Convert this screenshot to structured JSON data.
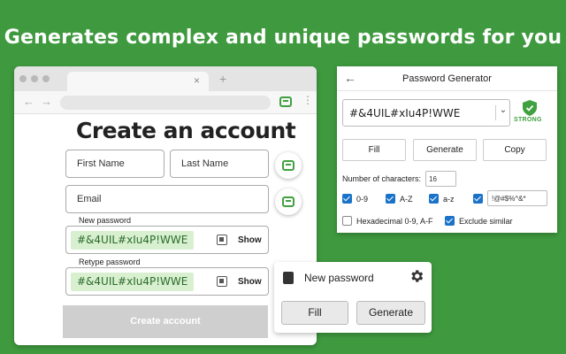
{
  "headline": "Generates complex and unique passwords for you",
  "browser": {
    "tab_close": "×",
    "new_tab": "+",
    "back": "←",
    "forward": "→",
    "menu": "⋮"
  },
  "form": {
    "title": "Create an account",
    "first_name_placeholder": "First Name",
    "last_name_placeholder": "Last Name",
    "email_placeholder": "Email",
    "new_password_label": "New password",
    "new_password_value": "#&4UIL#xIu4P!WWE",
    "retype_password_label": "Retype password",
    "retype_password_value": "#&4UIL#xIu4P!WWE",
    "show_label": "Show",
    "create_button": "Create account"
  },
  "generator": {
    "title": "Password Generator",
    "back": "←",
    "password": "#&4UIL#xIu4P!WWE",
    "strength": "STRONG",
    "fill": "Fill",
    "generate": "Generate",
    "copy": "Copy",
    "num_chars_label": "Number of characters:",
    "num_chars_value": "16",
    "opt_digits": "0-9",
    "opt_upper": "A-Z",
    "opt_lower": "a-z",
    "symbols_value": "!@#$%^&*",
    "opt_hex": "Hexadecimal 0-9, A-F",
    "opt_exclude": "Exclude similar",
    "caret": "⌄"
  },
  "popup": {
    "title": "New password",
    "fill": "Fill",
    "generate": "Generate"
  },
  "colors": {
    "background": "#3f9a3f",
    "accent": "#3fa13f",
    "checkbox": "#1a73c9"
  }
}
